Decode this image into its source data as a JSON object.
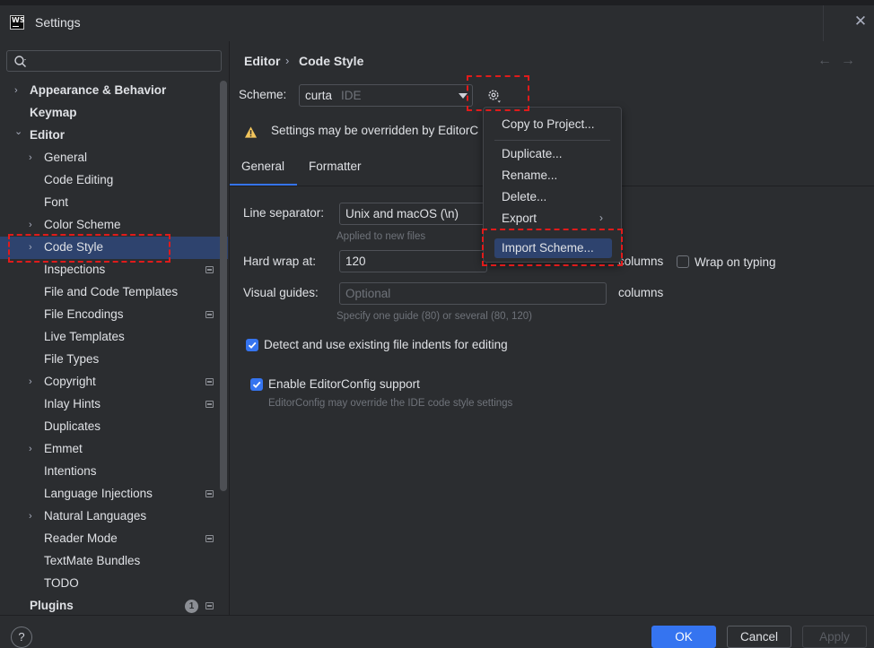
{
  "window": {
    "title": "Settings",
    "logo_text": "WS"
  },
  "search": {
    "placeholder": ""
  },
  "tree": {
    "items": [
      {
        "label": "Appearance & Behavior",
        "chevron": true,
        "bold": true,
        "level": 0,
        "badge": false
      },
      {
        "label": "Keymap",
        "chevron": false,
        "bold": true,
        "level": 0,
        "badge": false
      },
      {
        "label": "Editor",
        "chevron": "open",
        "bold": true,
        "level": 0,
        "badge": false
      },
      {
        "label": "General",
        "chevron": true,
        "bold": false,
        "level": 1,
        "badge": false
      },
      {
        "label": "Code Editing",
        "chevron": false,
        "bold": false,
        "level": 1,
        "badge": false
      },
      {
        "label": "Font",
        "chevron": false,
        "bold": false,
        "level": 1,
        "badge": false
      },
      {
        "label": "Color Scheme",
        "chevron": true,
        "bold": false,
        "level": 1,
        "badge": false
      },
      {
        "label": "Code Style",
        "chevron": true,
        "bold": false,
        "level": 1,
        "badge": false,
        "selected": true
      },
      {
        "label": "Inspections",
        "chevron": false,
        "bold": false,
        "level": 1,
        "badge": true
      },
      {
        "label": "File and Code Templates",
        "chevron": false,
        "bold": false,
        "level": 1,
        "badge": false
      },
      {
        "label": "File Encodings",
        "chevron": false,
        "bold": false,
        "level": 1,
        "badge": true
      },
      {
        "label": "Live Templates",
        "chevron": false,
        "bold": false,
        "level": 1,
        "badge": false
      },
      {
        "label": "File Types",
        "chevron": false,
        "bold": false,
        "level": 1,
        "badge": false
      },
      {
        "label": "Copyright",
        "chevron": true,
        "bold": false,
        "level": 1,
        "badge": true
      },
      {
        "label": "Inlay Hints",
        "chevron": false,
        "bold": false,
        "level": 1,
        "badge": true
      },
      {
        "label": "Duplicates",
        "chevron": false,
        "bold": false,
        "level": 1,
        "badge": false
      },
      {
        "label": "Emmet",
        "chevron": true,
        "bold": false,
        "level": 1,
        "badge": false
      },
      {
        "label": "Intentions",
        "chevron": false,
        "bold": false,
        "level": 1,
        "badge": false
      },
      {
        "label": "Language Injections",
        "chevron": false,
        "bold": false,
        "level": 1,
        "badge": true
      },
      {
        "label": "Natural Languages",
        "chevron": true,
        "bold": false,
        "level": 1,
        "badge": false
      },
      {
        "label": "Reader Mode",
        "chevron": false,
        "bold": false,
        "level": 1,
        "badge": true
      },
      {
        "label": "TextMate Bundles",
        "chevron": false,
        "bold": false,
        "level": 1,
        "badge": false
      },
      {
        "label": "TODO",
        "chevron": false,
        "bold": false,
        "level": 1,
        "badge": false
      },
      {
        "label": "Plugins",
        "chevron": false,
        "bold": true,
        "level": 0,
        "badge": true,
        "count": "1"
      }
    ]
  },
  "breadcrumb": {
    "parent": "Editor",
    "separator": "›",
    "current": "Code Style"
  },
  "nav": {
    "back": "←",
    "forward": "→"
  },
  "scheme": {
    "label": "Scheme:",
    "name": "curta",
    "scope": "IDE"
  },
  "warning": {
    "text": "Settings may be overridden by EditorC"
  },
  "tabs": [
    {
      "label": "General",
      "active": true
    },
    {
      "label": "Formatter",
      "active": false
    }
  ],
  "general": {
    "line_separator": {
      "label": "Line separator:",
      "value": "Unix and macOS (\\n)",
      "hint": "Applied to new files"
    },
    "hard_wrap": {
      "label": "Hard wrap at:",
      "value": "120",
      "unit": "columns",
      "wrap_on_typing": "Wrap on typing",
      "wrap_on_typing_checked": false
    },
    "visual_guides": {
      "label": "Visual guides:",
      "placeholder": "Optional",
      "unit": "columns",
      "hint": "Specify one guide (80) or several (80, 120)"
    },
    "detect_indents": {
      "label": "Detect and use existing file indents for editing",
      "checked": true
    },
    "editorconfig": {
      "label": "Enable EditorConfig support",
      "checked": true,
      "hint": "EditorConfig may override the IDE code style settings"
    }
  },
  "scheme_menu": {
    "items": [
      {
        "label": "Copy to Project..."
      },
      {
        "label": "Duplicate..."
      },
      {
        "label": "Rename..."
      },
      {
        "label": "Delete..."
      },
      {
        "label": "Export",
        "submenu": true
      },
      {
        "label": "Import Scheme...",
        "highlighted": true
      }
    ]
  },
  "footer": {
    "help": "?",
    "ok": "OK",
    "cancel": "Cancel",
    "apply": "Apply"
  },
  "colors": {
    "accent": "#3574f0",
    "selection": "#2e436e",
    "highlight_frame": "#e01b1b",
    "warning": "#f2c55c"
  }
}
